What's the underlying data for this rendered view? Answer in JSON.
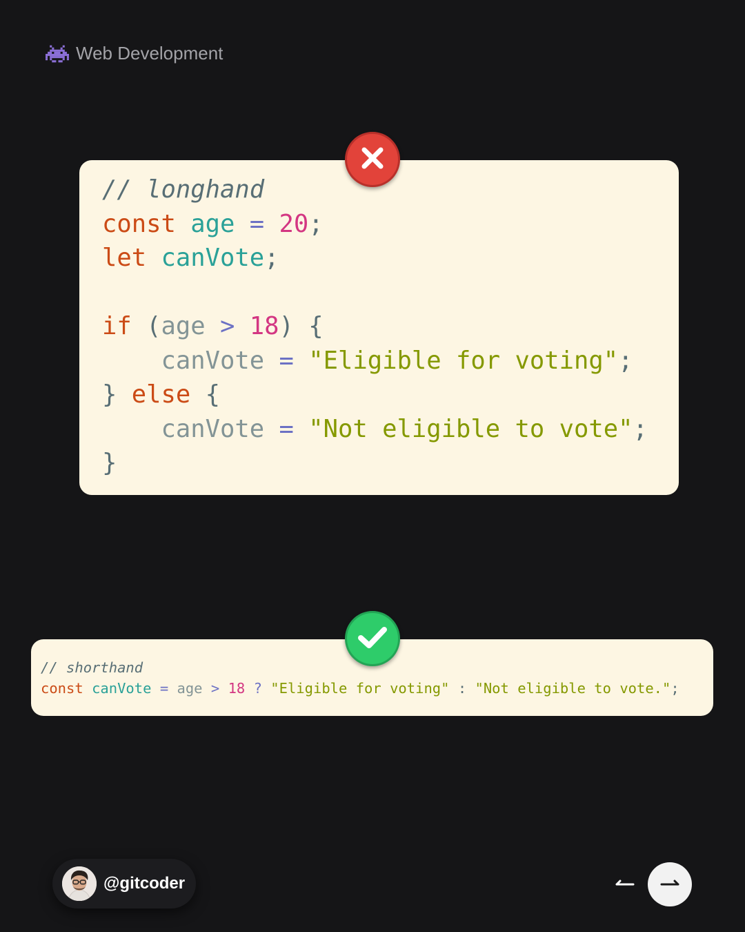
{
  "header": {
    "icon": "space-invader-icon",
    "title": "Web Development"
  },
  "longhand": {
    "status_icon": "cross-icon",
    "lines": {
      "l1": {
        "comment": "// longhand"
      },
      "l2": {
        "kw": "const",
        "var": "age",
        "op": "=",
        "num": "20",
        "punct": ";"
      },
      "l3": {
        "kw": "let",
        "var": "canVote",
        "punct": ";"
      },
      "l5": {
        "kw": "if",
        "open": "(",
        "id": "age",
        "op": ">",
        "num": "18",
        "close": ")",
        "brace": "{"
      },
      "l6": {
        "indent": "    ",
        "id": "canVote",
        "op": "=",
        "str": "\"Eligible for voting\"",
        "punct": ";"
      },
      "l7": {
        "brace_close": "}",
        "kw": "else",
        "brace": "{"
      },
      "l8": {
        "indent": "    ",
        "id": "canVote",
        "op": "=",
        "str": "\"Not eligible to vote\"",
        "punct": ";"
      },
      "l9": {
        "brace_close": "}"
      }
    }
  },
  "shorthand": {
    "status_icon": "check-icon",
    "comment": "// shorthand",
    "kw": "const",
    "var": "canVote",
    "eq": "=",
    "id": "age",
    "gt": ">",
    "num": "18",
    "q": "?",
    "str1": "\"Eligible for voting\"",
    "colon": ":",
    "str2": "\"Not eligible to vote.\"",
    "punct": ";"
  },
  "footer": {
    "avatar_icon": "avatar",
    "handle": "@gitcoder",
    "prev_icon": "arrow-left-icon",
    "next_icon": "arrow-right-icon"
  },
  "colors": {
    "background": "#151517",
    "card": "#fdf6e3",
    "keyword": "#cb4b16",
    "variable": "#2aa198",
    "number": "#d33682",
    "string": "#859900",
    "operator": "#6c71c4",
    "error": "#e2433a",
    "success": "#2ecc6a"
  }
}
